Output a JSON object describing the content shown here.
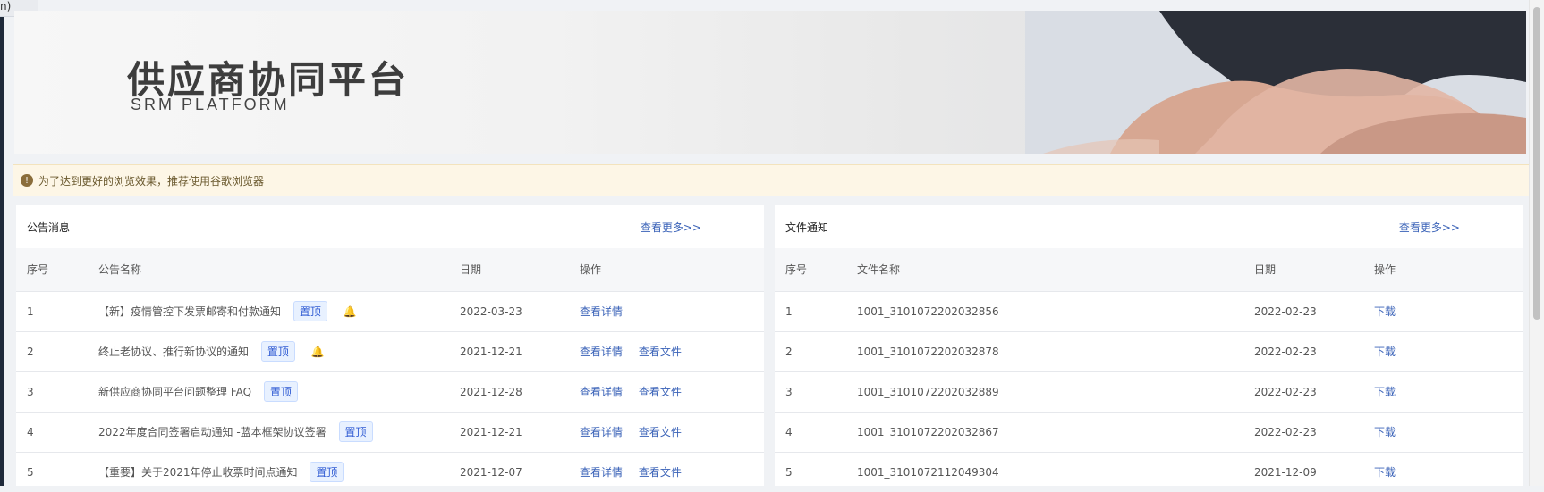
{
  "top_left_stub": "n)",
  "banner": {
    "title": "供应商协同平台",
    "subtitle": "SRM  PLATFORM"
  },
  "alert": {
    "icon": "warning-circle-icon",
    "text": "为了达到更好的浏览效果，推荐使用谷歌浏览器"
  },
  "announcements": {
    "title": "公告消息",
    "more": "查看更多>>",
    "headers": [
      "序号",
      "公告名称",
      "日期",
      "操作"
    ],
    "rows": [
      {
        "no": "1",
        "title": "【新】疫情管控下发票邮寄和付款通知",
        "pin": "置顶",
        "bell": true,
        "date": "2022-03-23",
        "actions": [
          "查看详情"
        ]
      },
      {
        "no": "2",
        "title": "终止老协议、推行新协议的通知",
        "pin": "置顶",
        "bell": true,
        "date": "2021-12-21",
        "actions": [
          "查看详情",
          "查看文件"
        ]
      },
      {
        "no": "3",
        "title": "新供应商协同平台问题整理 FAQ",
        "pin": "置顶",
        "bell": false,
        "date": "2021-12-28",
        "actions": [
          "查看详情",
          "查看文件"
        ]
      },
      {
        "no": "4",
        "title": "2022年度合同签署启动通知 -蓝本框架协议签署",
        "pin": "置顶",
        "bell": false,
        "date": "2021-12-21",
        "actions": [
          "查看详情",
          "查看文件"
        ]
      },
      {
        "no": "5",
        "title": "【重要】关于2021年停止收票时间点通知",
        "pin": "置顶",
        "bell": false,
        "date": "2021-12-07",
        "actions": [
          "查看详情",
          "查看文件"
        ]
      }
    ]
  },
  "files": {
    "title": "文件通知",
    "more": "查看更多>>",
    "headers": [
      "序号",
      "文件名称",
      "日期",
      "操作"
    ],
    "rows": [
      {
        "no": "1",
        "name": "1001_3101072202032856",
        "date": "2022-02-23",
        "action": "下载"
      },
      {
        "no": "2",
        "name": "1001_3101072202032878",
        "date": "2022-02-23",
        "action": "下载"
      },
      {
        "no": "3",
        "name": "1001_3101072202032889",
        "date": "2022-02-23",
        "action": "下载"
      },
      {
        "no": "4",
        "name": "1001_3101072202032867",
        "date": "2022-02-23",
        "action": "下载"
      },
      {
        "no": "5",
        "name": "1001_3101072112049304",
        "date": "2021-12-09",
        "action": "下载"
      }
    ]
  }
}
